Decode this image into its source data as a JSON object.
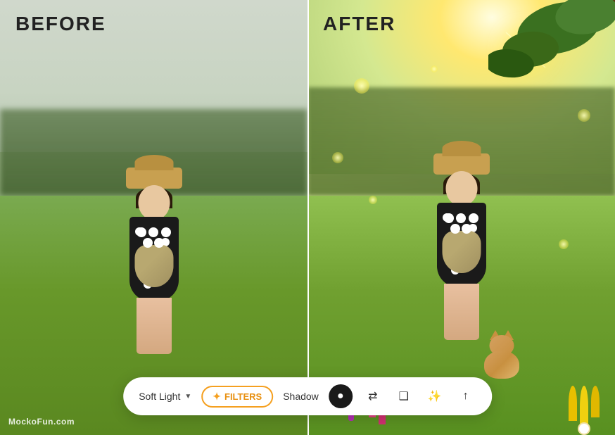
{
  "labels": {
    "before": "BEFORE",
    "after": "AFTER"
  },
  "toolbar": {
    "blend_mode": "Soft Light",
    "blend_arrow": "▼",
    "filters_label": "FILTERS",
    "shadow_label": "Shadow",
    "filters_star": "✦"
  },
  "watermark": "MockoFun.com",
  "icons": {
    "circle": "●",
    "swap": "⇄",
    "layers": "❑",
    "magic": "✨",
    "up": "↑"
  }
}
